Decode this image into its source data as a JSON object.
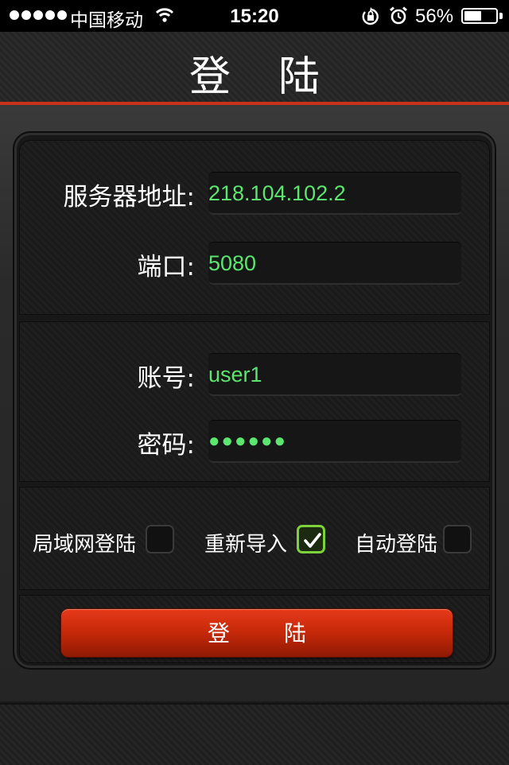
{
  "status_bar": {
    "carrier": "中国移动",
    "time": "15:20",
    "battery_percent_text": "56%",
    "battery_level": 0.56,
    "icons": [
      "signal-dots-icon",
      "wifi-icon",
      "rotation-lock-icon",
      "alarm-icon",
      "battery-icon"
    ]
  },
  "navbar": {
    "title": "登陆"
  },
  "form": {
    "server_label": "服务器地址:",
    "server_value": "218.104.102.2",
    "port_label": "端口:",
    "port_value": "5080",
    "account_label": "账号:",
    "account_value": "user1",
    "password_label": "密码:",
    "password_value": "●●●●●●"
  },
  "options": {
    "lan_label": "局域网登陆",
    "lan_checked": false,
    "reimport_label": "重新导入",
    "reimport_checked": true,
    "autologin_label": "自动登陆",
    "autologin_checked": false
  },
  "login_button": {
    "label": "登陆"
  },
  "colors": {
    "accent_red": "#c8321a",
    "input_text_green": "#5be66f",
    "checkbox_green": "#7bd23a"
  }
}
